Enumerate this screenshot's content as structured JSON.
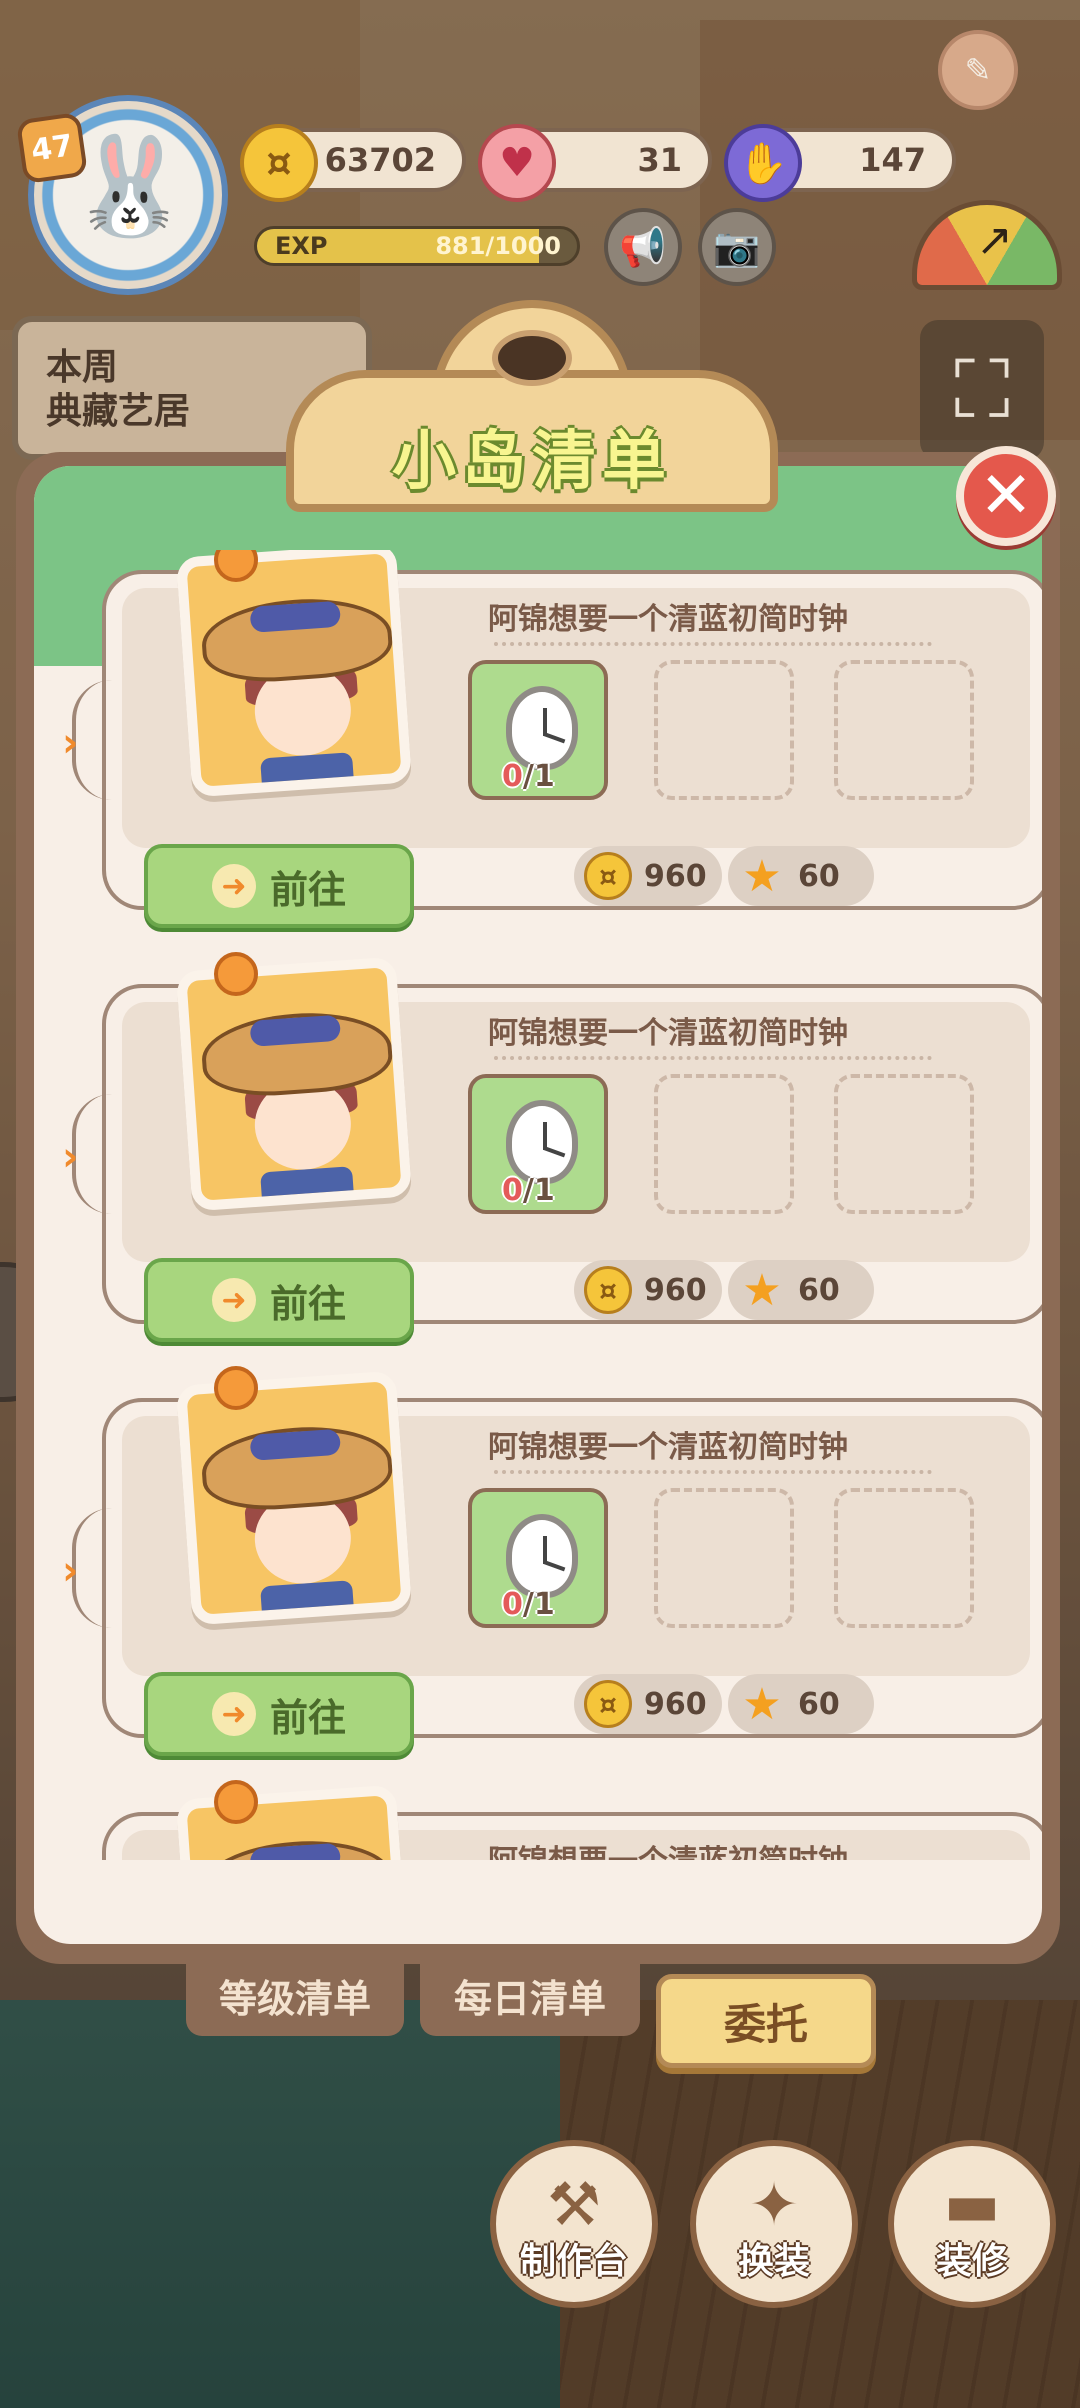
{
  "hud": {
    "level": "47",
    "coins": "63702",
    "hearts": "31",
    "energy": "147",
    "exp_label": "EXP",
    "exp_value": "881/1000",
    "exp_progress": 0.881,
    "weekly_line1": "本周",
    "weekly_line2": "典藏艺居"
  },
  "modal": {
    "title": "小岛清单",
    "entries": [
      {
        "description": "阿锦想要一个清蓝初简时钟",
        "progress_have": "0",
        "progress_total": "/1",
        "go_label": "前往",
        "coin_reward": "960",
        "star_reward": "60"
      },
      {
        "description": "阿锦想要一个清蓝初简时钟",
        "progress_have": "0",
        "progress_total": "/1",
        "go_label": "前往",
        "coin_reward": "960",
        "star_reward": "60"
      },
      {
        "description": "阿锦想要一个清蓝初简时钟",
        "progress_have": "0",
        "progress_total": "/1",
        "go_label": "前往",
        "coin_reward": "960",
        "star_reward": "60"
      },
      {
        "description": "阿锦想要一个清蓝初简时钟"
      }
    ]
  },
  "tabs": {
    "level_list": "等级清单",
    "daily_list": "每日清单",
    "entrust": "委托"
  },
  "tools": {
    "craft": "制作台",
    "dress": "换装",
    "decorate": "装修"
  },
  "colors": {
    "accent_green": "#7cc486",
    "frame_brown": "#8c6b55",
    "close_red": "#e4584c",
    "title_yellow": "#f8f590"
  }
}
